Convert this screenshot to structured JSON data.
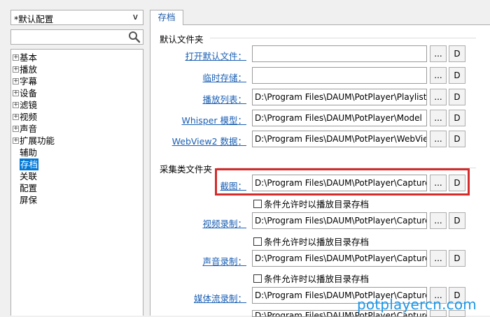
{
  "sidebar": {
    "preset_value": "*默认配置",
    "preset_arrow": "v",
    "search_placeholder": "",
    "tree": [
      {
        "label": "基本",
        "expandable": true
      },
      {
        "label": "播放",
        "expandable": true
      },
      {
        "label": "字幕",
        "expandable": true
      },
      {
        "label": "设备",
        "expandable": true
      },
      {
        "label": "滤镜",
        "expandable": true
      },
      {
        "label": "视频",
        "expandable": true
      },
      {
        "label": "声音",
        "expandable": true
      },
      {
        "label": "扩展功能",
        "expandable": true
      },
      {
        "label": "辅助",
        "expandable": false
      },
      {
        "label": "存档",
        "expandable": false,
        "selected": true
      },
      {
        "label": "关联",
        "expandable": false
      },
      {
        "label": "配置",
        "expandable": false
      },
      {
        "label": "屏保",
        "expandable": false
      }
    ]
  },
  "main": {
    "tab_label": "存档",
    "default_folders": {
      "title": "默认文件夹",
      "rows": [
        {
          "label": "打开默认文件：",
          "value": ""
        },
        {
          "label": "临时存储：",
          "value": ""
        },
        {
          "label": "播放列表：",
          "value": "D:\\Program Files\\DAUM\\PotPlayer\\Playlist"
        },
        {
          "label": "Whisper 模型：",
          "value": "D:\\Program Files\\DAUM\\PotPlayer\\Model"
        },
        {
          "label": "WebView2 数据：",
          "value": "D:\\Program Files\\DAUM\\PotPlayer\\WebView2"
        }
      ]
    },
    "capture_folders": {
      "title": "采集类文件夹",
      "rows": [
        {
          "label": "截图：",
          "value": "D:\\Program Files\\DAUM\\PotPlayer\\Capture",
          "highlighted": true
        },
        {
          "label": "视频录制：",
          "value": "D:\\Program Files\\DAUM\\PotPlayer\\Capture",
          "checkbox": "条件允许时以播放目录存档"
        },
        {
          "label": "声音录制：",
          "value": "D:\\Program Files\\DAUM\\PotPlayer\\Capture",
          "checkbox": "条件允许时以播放目录存档"
        },
        {
          "label": "媒体流录制：",
          "value": "D:\\Program Files\\DAUM\\PotPlayer\\Capture",
          "checkbox": "条件允许时以播放目录存档"
        },
        {
          "label": "",
          "value": "D:\\Program Files\\DAUM\\PotPlayer\\Capture"
        }
      ],
      "screenshot_checkbox": "条件允许时以播放目录存档"
    },
    "browse_label": "...",
    "default_label": "D"
  },
  "watermark": "potplayercn.com",
  "colors": {
    "link": "#1a5fb4",
    "highlight": "#d52b2b",
    "watermark": "#1e96e6",
    "selection": "#0078d7"
  }
}
